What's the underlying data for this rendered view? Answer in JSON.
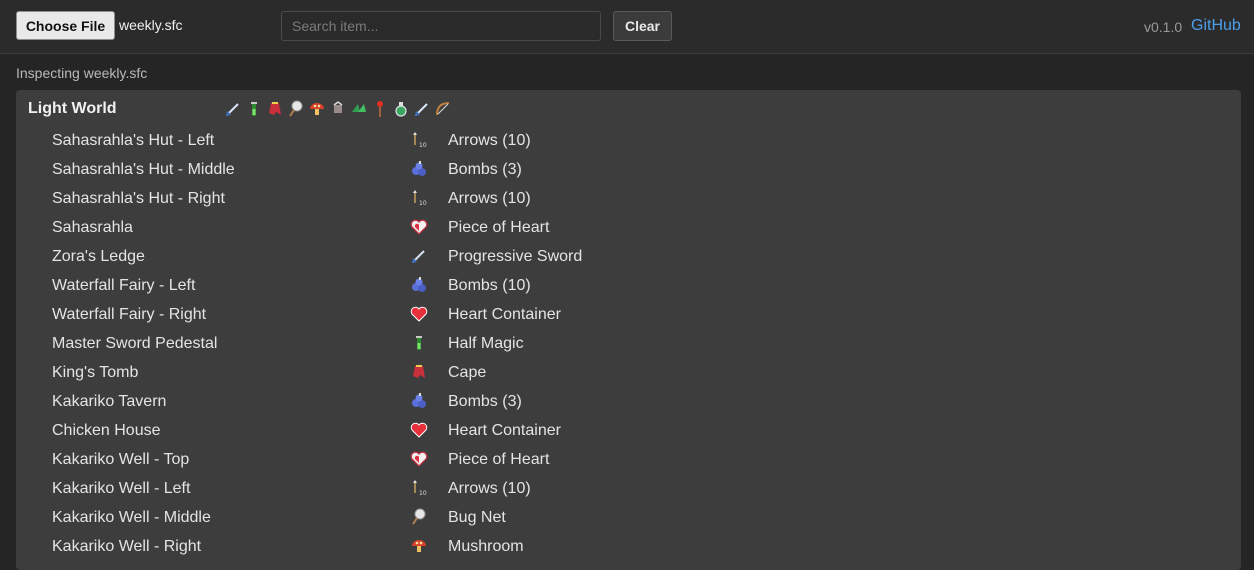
{
  "toolbar": {
    "choose_file_label": "Choose File",
    "filename": "weekly.sfc",
    "search_placeholder": "Search item...",
    "search_value": "",
    "clear_label": "Clear",
    "version": "v0.1.0",
    "github_label": "GitHub"
  },
  "status": "Inspecting weekly.sfc",
  "region": {
    "title": "Light World",
    "icons": [
      "sword-icon",
      "half-magic-icon",
      "cape-icon",
      "bug-net-icon",
      "mushroom-icon",
      "hookshot-icon",
      "flippers-icon",
      "fire-rod-icon",
      "bottle-icon",
      "sword-icon",
      "bow-icon"
    ]
  },
  "rows": [
    {
      "location": "Sahasrahla's Hut - Left",
      "item": "Arrows (10)",
      "icon": "arrows"
    },
    {
      "location": "Sahasrahla's Hut - Middle",
      "item": "Bombs (3)",
      "icon": "bombs"
    },
    {
      "location": "Sahasrahla's Hut - Right",
      "item": "Arrows (10)",
      "icon": "arrows"
    },
    {
      "location": "Sahasrahla",
      "item": "Piece of Heart",
      "icon": "heart-piece"
    },
    {
      "location": "Zora's Ledge",
      "item": "Progressive Sword",
      "icon": "sword"
    },
    {
      "location": "Waterfall Fairy - Left",
      "item": "Bombs (10)",
      "icon": "bombs"
    },
    {
      "location": "Waterfall Fairy - Right",
      "item": "Heart Container",
      "icon": "heart"
    },
    {
      "location": "Master Sword Pedestal",
      "item": "Half Magic",
      "icon": "half-magic"
    },
    {
      "location": "King's Tomb",
      "item": "Cape",
      "icon": "cape"
    },
    {
      "location": "Kakariko Tavern",
      "item": "Bombs (3)",
      "icon": "bombs"
    },
    {
      "location": "Chicken House",
      "item": "Heart Container",
      "icon": "heart"
    },
    {
      "location": "Kakariko Well - Top",
      "item": "Piece of Heart",
      "icon": "heart-piece"
    },
    {
      "location": "Kakariko Well - Left",
      "item": "Arrows (10)",
      "icon": "arrows"
    },
    {
      "location": "Kakariko Well - Middle",
      "item": "Bug Net",
      "icon": "bug-net"
    },
    {
      "location": "Kakariko Well - Right",
      "item": "Mushroom",
      "icon": "mushroom"
    }
  ],
  "colors": {
    "background": "#252525",
    "panel": "#3d3d3d",
    "link": "#4d9fea"
  }
}
